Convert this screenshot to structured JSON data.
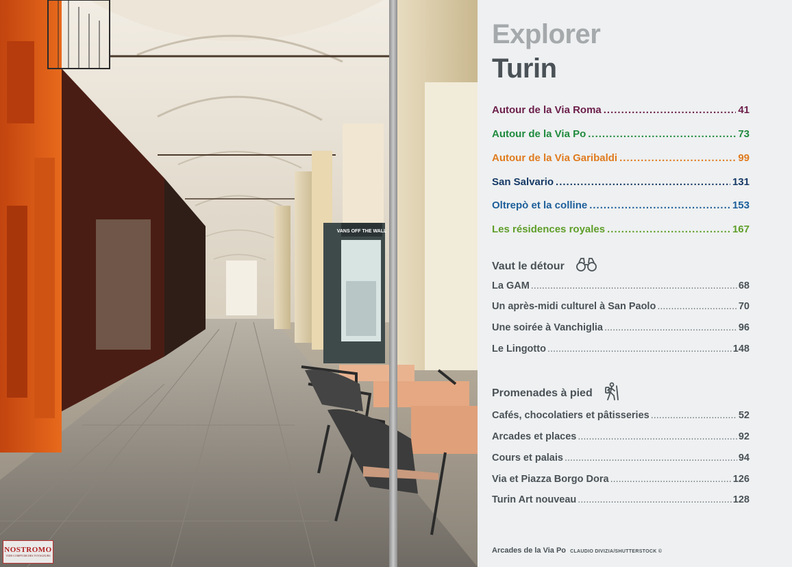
{
  "panel": {
    "title_line1": "Explorer",
    "title_line2": "Turin",
    "toc": [
      {
        "label": "Autour de la Via Roma",
        "page": "41",
        "color": "#6b1e4a"
      },
      {
        "label": "Autour de la Via Po",
        "page": "73",
        "color": "#1f8a3d"
      },
      {
        "label": "Autour de la Via Garibaldi",
        "page": "99",
        "color": "#e07b1f"
      },
      {
        "label": "San Salvario",
        "page": "131",
        "color": "#173a66"
      },
      {
        "label": "Oltrepò et la colline",
        "page": "153",
        "color": "#1d5f9a"
      },
      {
        "label": "Les résidences royales",
        "page": "167",
        "color": "#5f9e2a"
      }
    ],
    "section_detour": {
      "heading": "Vaut le détour",
      "icon": "binoculars-icon",
      "items": [
        {
          "label": "La GAM",
          "page": "68"
        },
        {
          "label": "Un après-midi culturel à San Paolo",
          "page": "70"
        },
        {
          "label": "Une soirée à Vanchiglia",
          "page": "96"
        },
        {
          "label": "Le Lingotto",
          "page": "148"
        }
      ]
    },
    "section_walks": {
      "heading": "Promenades à pied",
      "icon": "hiker-icon",
      "items": [
        {
          "label": "Cafés, chocolatiers et pâtisseries",
          "page": "52"
        },
        {
          "label": "Arcades et places",
          "page": "92"
        },
        {
          "label": "Cours et palais",
          "page": "94"
        },
        {
          "label": "Via et Piazza Borgo Dora",
          "page": "126"
        },
        {
          "label": "Turin Art nouveau",
          "page": "128"
        }
      ]
    },
    "caption": "Arcades de la Via Po",
    "credit": "CLAUDIO DIVIZIA/SHUTTERSTOCK ©"
  },
  "photo": {
    "kiosk_sign": "VANS OFF THE WALL",
    "watermark_title": "NOSTROMO",
    "watermark_tagline": "VIDE-COMPTOIR DES VOYAGEURS"
  }
}
